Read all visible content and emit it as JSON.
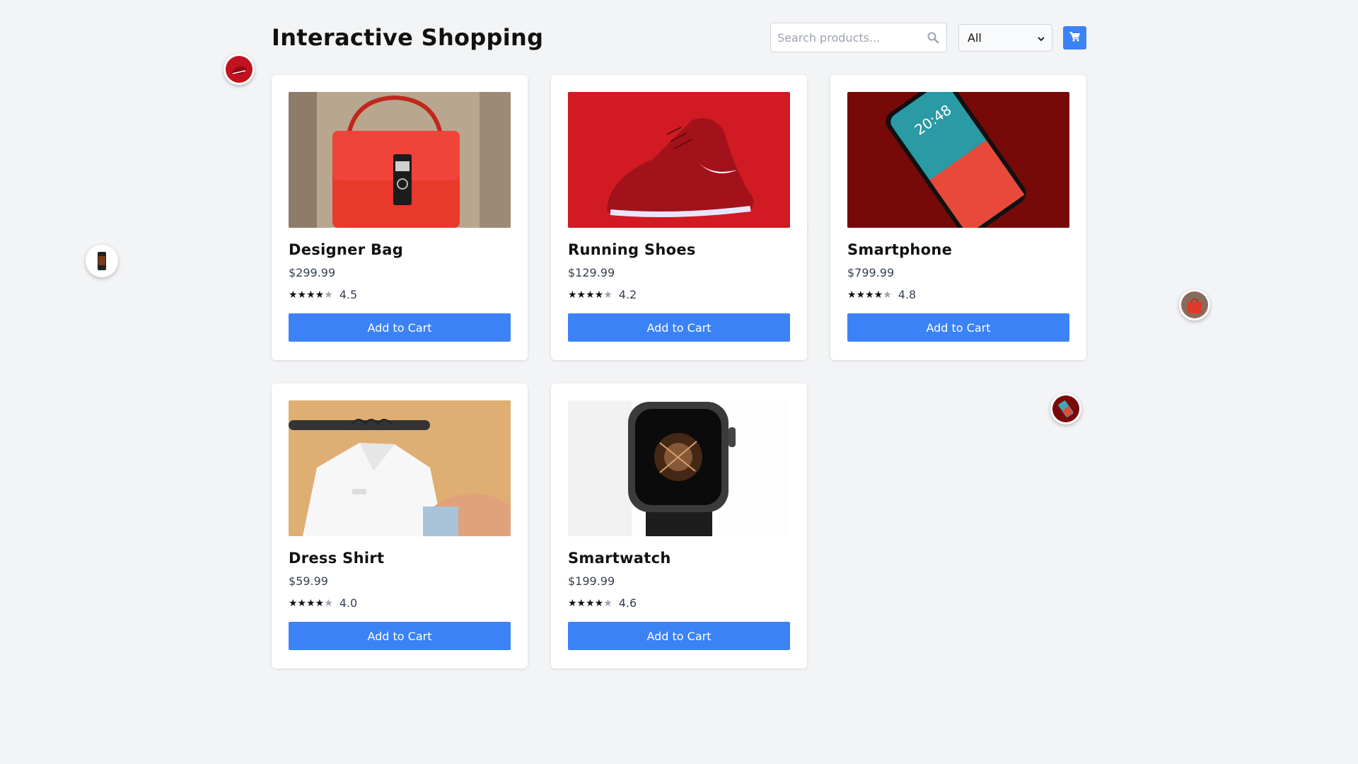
{
  "header": {
    "title": "Interactive Shopping",
    "search_placeholder": "Search products...",
    "filter_selected": "All"
  },
  "products": [
    {
      "name": "Designer Bag",
      "price": "$299.99",
      "stars": "★★★★",
      "stars_dim": "★",
      "rating": "4.5",
      "button": "Add to Cart"
    },
    {
      "name": "Running Shoes",
      "price": "$129.99",
      "stars": "★★★★",
      "stars_dim": "★",
      "rating": "4.2",
      "button": "Add to Cart"
    },
    {
      "name": "Smartphone",
      "price": "$799.99",
      "stars": "★★★★",
      "stars_dim": "★",
      "rating": "4.8",
      "button": "Add to Cart"
    },
    {
      "name": "Dress Shirt",
      "price": "$59.99",
      "stars": "★★★★",
      "stars_dim": "★",
      "rating": "4.0",
      "button": "Add to Cart"
    },
    {
      "name": "Smartwatch",
      "price": "$199.99",
      "stars": "★★★★",
      "stars_dim": "★",
      "rating": "4.6",
      "button": "Add to Cart"
    }
  ],
  "colors": {
    "accent": "#3b82f6",
    "background": "#f3f4f6"
  },
  "icons": [
    "search-icon",
    "shopping-cart-icon",
    "chevron-down-icon"
  ]
}
